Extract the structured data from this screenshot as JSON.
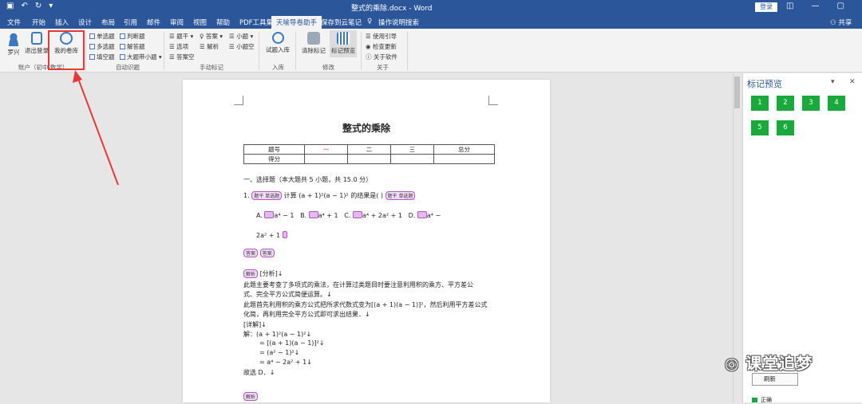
{
  "window": {
    "title": "整式的乘除.docx - Word",
    "login_label": "登录",
    "share_label": "共享"
  },
  "tabs": [
    "文件",
    "开始",
    "插入",
    "设计",
    "布局",
    "引用",
    "邮件",
    "审阅",
    "视图",
    "帮助",
    "PDF工具集",
    "天喻导卷助手",
    "保存到云笔记",
    "操作说明搜索"
  ],
  "active_tab": "天喻导卷助手",
  "ribbon": {
    "user_name": "罗兴",
    "logout": "退出登录",
    "my_papers": "我的卷库",
    "group_account": "账户（初中 数学）",
    "auto": [
      "单选题",
      "多选题",
      "填空题",
      "判断题",
      "解答题",
      "大题带小题"
    ],
    "group_auto": "自动识题",
    "manual": [
      "题干",
      "选项",
      "答案空",
      "答案",
      "解析",
      "小题",
      "小题空"
    ],
    "group_manual": "手动标记",
    "import_label": "试题入库",
    "group_import": "入库",
    "clear_label": "清除标记",
    "preview_label": "标记预览",
    "group_modify": "修改",
    "about": [
      "使用引导",
      "检查更新",
      "关于软件"
    ],
    "group_about": "关于"
  },
  "doc": {
    "title": "整式的乘除",
    "score_table": [
      [
        "题号",
        "一",
        "二",
        "三",
        "总分"
      ],
      [
        "得分",
        "",
        "",
        "",
        ""
      ]
    ],
    "section": "一、选择题（本大题共 5 小题，共 15.0 分）",
    "q1": "计算 (a + 1)²(a − 1)² 的结果是(    )",
    "optA": "A.",
    "optA_expr": "a⁴ − 1",
    "optB": "B.",
    "optB_expr": "a⁴ + 1",
    "optC": "C.",
    "optC_expr": "a⁴ + 2a² + 1",
    "optD": "D.",
    "optD_expr": "a⁴ −",
    "optD_expr2": "2a² + 1",
    "tag_stem": "题干 单选题",
    "tag_answer": "答案",
    "tag_analysis": "解析",
    "analysis_head": "[分析]↓",
    "a1": "此题主要考查了多项式的乘法，在计算过类题目时要注意利用积的乘方、平方差公",
    "a2": "式、完全平方公式简便运算。↓",
    "a3": "此题首先利用积的乘方公式把所求代数式变为[(a + 1)(a − 1)]²，然后利用平方差公式",
    "a4": "化简，再利用完全平方公式即可求出结果．↓",
    "detail": "[详解]↓",
    "s1": "解：(a + 1)²(a − 1)²↓",
    "s2": "= [(a + 1)(a − 1)]²↓",
    "s3": "= (a² − 1)²↓",
    "s4": "= a⁴ − 2a² + 1↓",
    "s5": "故选 D．↓"
  },
  "pane": {
    "title": "标记预览",
    "marks": [
      "1",
      "2",
      "3",
      "4",
      "5",
      "6"
    ],
    "refresh": "刷新",
    "legend": "正确",
    "watermark": "课堂追梦"
  },
  "colors": {
    "brand": "#2b579a",
    "mark_green": "#1aaa3c",
    "highlight_red": "#e53935",
    "tag_purple": "#b455c6"
  }
}
